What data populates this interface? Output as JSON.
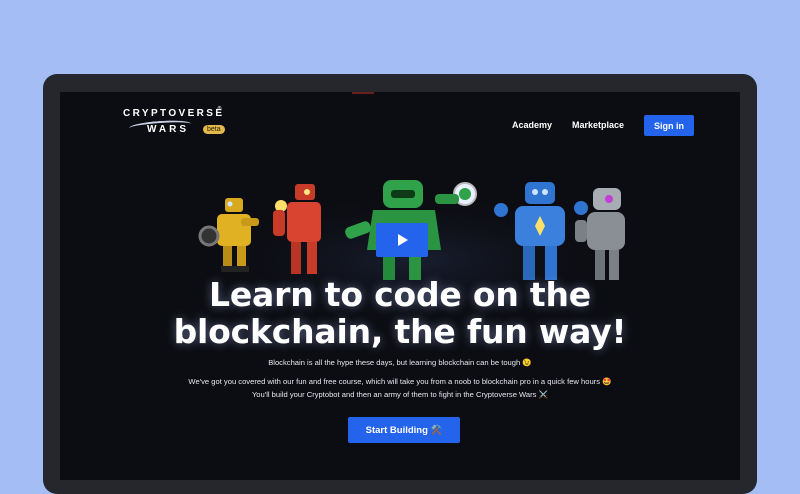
{
  "header": {
    "logo_top": "CRYPTOVERSE",
    "logo_reg": "®",
    "logo_bottom": "WARS",
    "beta_badge": "beta",
    "nav": [
      {
        "label": "Academy"
      },
      {
        "label": "Marketplace"
      }
    ],
    "signin_label": "Sign in"
  },
  "hero": {
    "title_line_1": "Learn to code on the",
    "title_line_2": "blockchain, the fun way!",
    "line_1": "Blockchain is all the hype these days, but learning blockchain can be tough 😉",
    "line_2": "We've got you covered with our fun and free course, which will take you from a noob to blockchain pro in a quick few hours 🤩",
    "line_3": "You'll build your Cryptobot and then an army of them to fight in the Cryptoverse Wars ⚔️",
    "cta_label": "Start Building ⚒️"
  },
  "robots": [
    {
      "name": "yellow-robot",
      "color": "#e0b123"
    },
    {
      "name": "red-robot",
      "color": "#d8442f"
    },
    {
      "name": "green-robot",
      "color": "#2fa24a"
    },
    {
      "name": "blue-robot",
      "color": "#2f74d0"
    },
    {
      "name": "grey-robot",
      "color": "#8a8f96"
    }
  ],
  "colors": {
    "background": "#a4bdf4",
    "screen": "#0c0d12",
    "accent": "#2463eb",
    "beta": "#e3b84c"
  },
  "icons": {
    "video": "play-icon"
  }
}
